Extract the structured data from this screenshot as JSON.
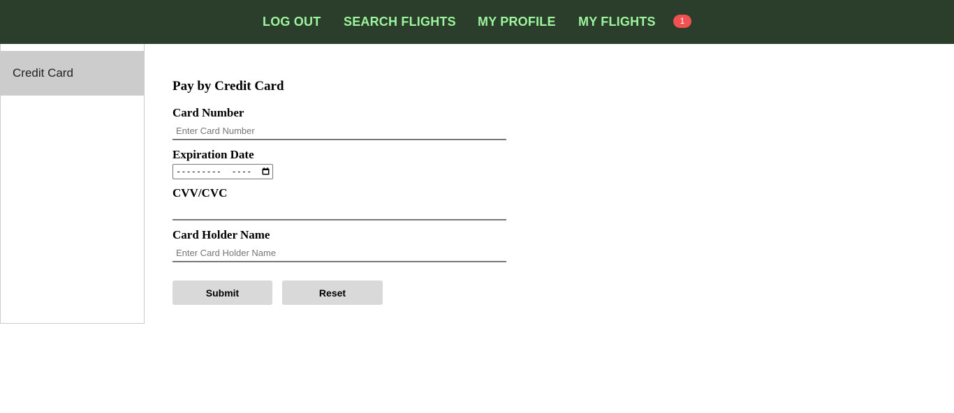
{
  "nav": {
    "items": [
      {
        "label": "LOG OUT"
      },
      {
        "label": "SEARCH FLIGHTS"
      },
      {
        "label": "MY PROFILE"
      },
      {
        "label": "MY FLIGHTS"
      }
    ],
    "badge_count": "1"
  },
  "sidebar": {
    "items": [
      {
        "label": "Credit Card"
      }
    ]
  },
  "form": {
    "title": "Pay by Credit Card",
    "card_number": {
      "label": "Card Number",
      "placeholder": "Enter Card Number",
      "value": ""
    },
    "expiration": {
      "label": "Expiration Date",
      "display": "---------  ----"
    },
    "cvv": {
      "label": "CVV/CVC",
      "placeholder": "",
      "value": ""
    },
    "holder": {
      "label": "Card Holder Name",
      "placeholder": "Enter Card Holder Name",
      "value": ""
    },
    "submit_label": "Submit",
    "reset_label": "Reset"
  },
  "colors": {
    "navbar_bg": "#2b3d2b",
    "nav_link": "#9df59d",
    "badge": "#f05252",
    "sidebar_active": "#cccccc",
    "button_bg": "#d9d9d9"
  },
  "icons": {
    "date_picker": "calendar-icon"
  }
}
